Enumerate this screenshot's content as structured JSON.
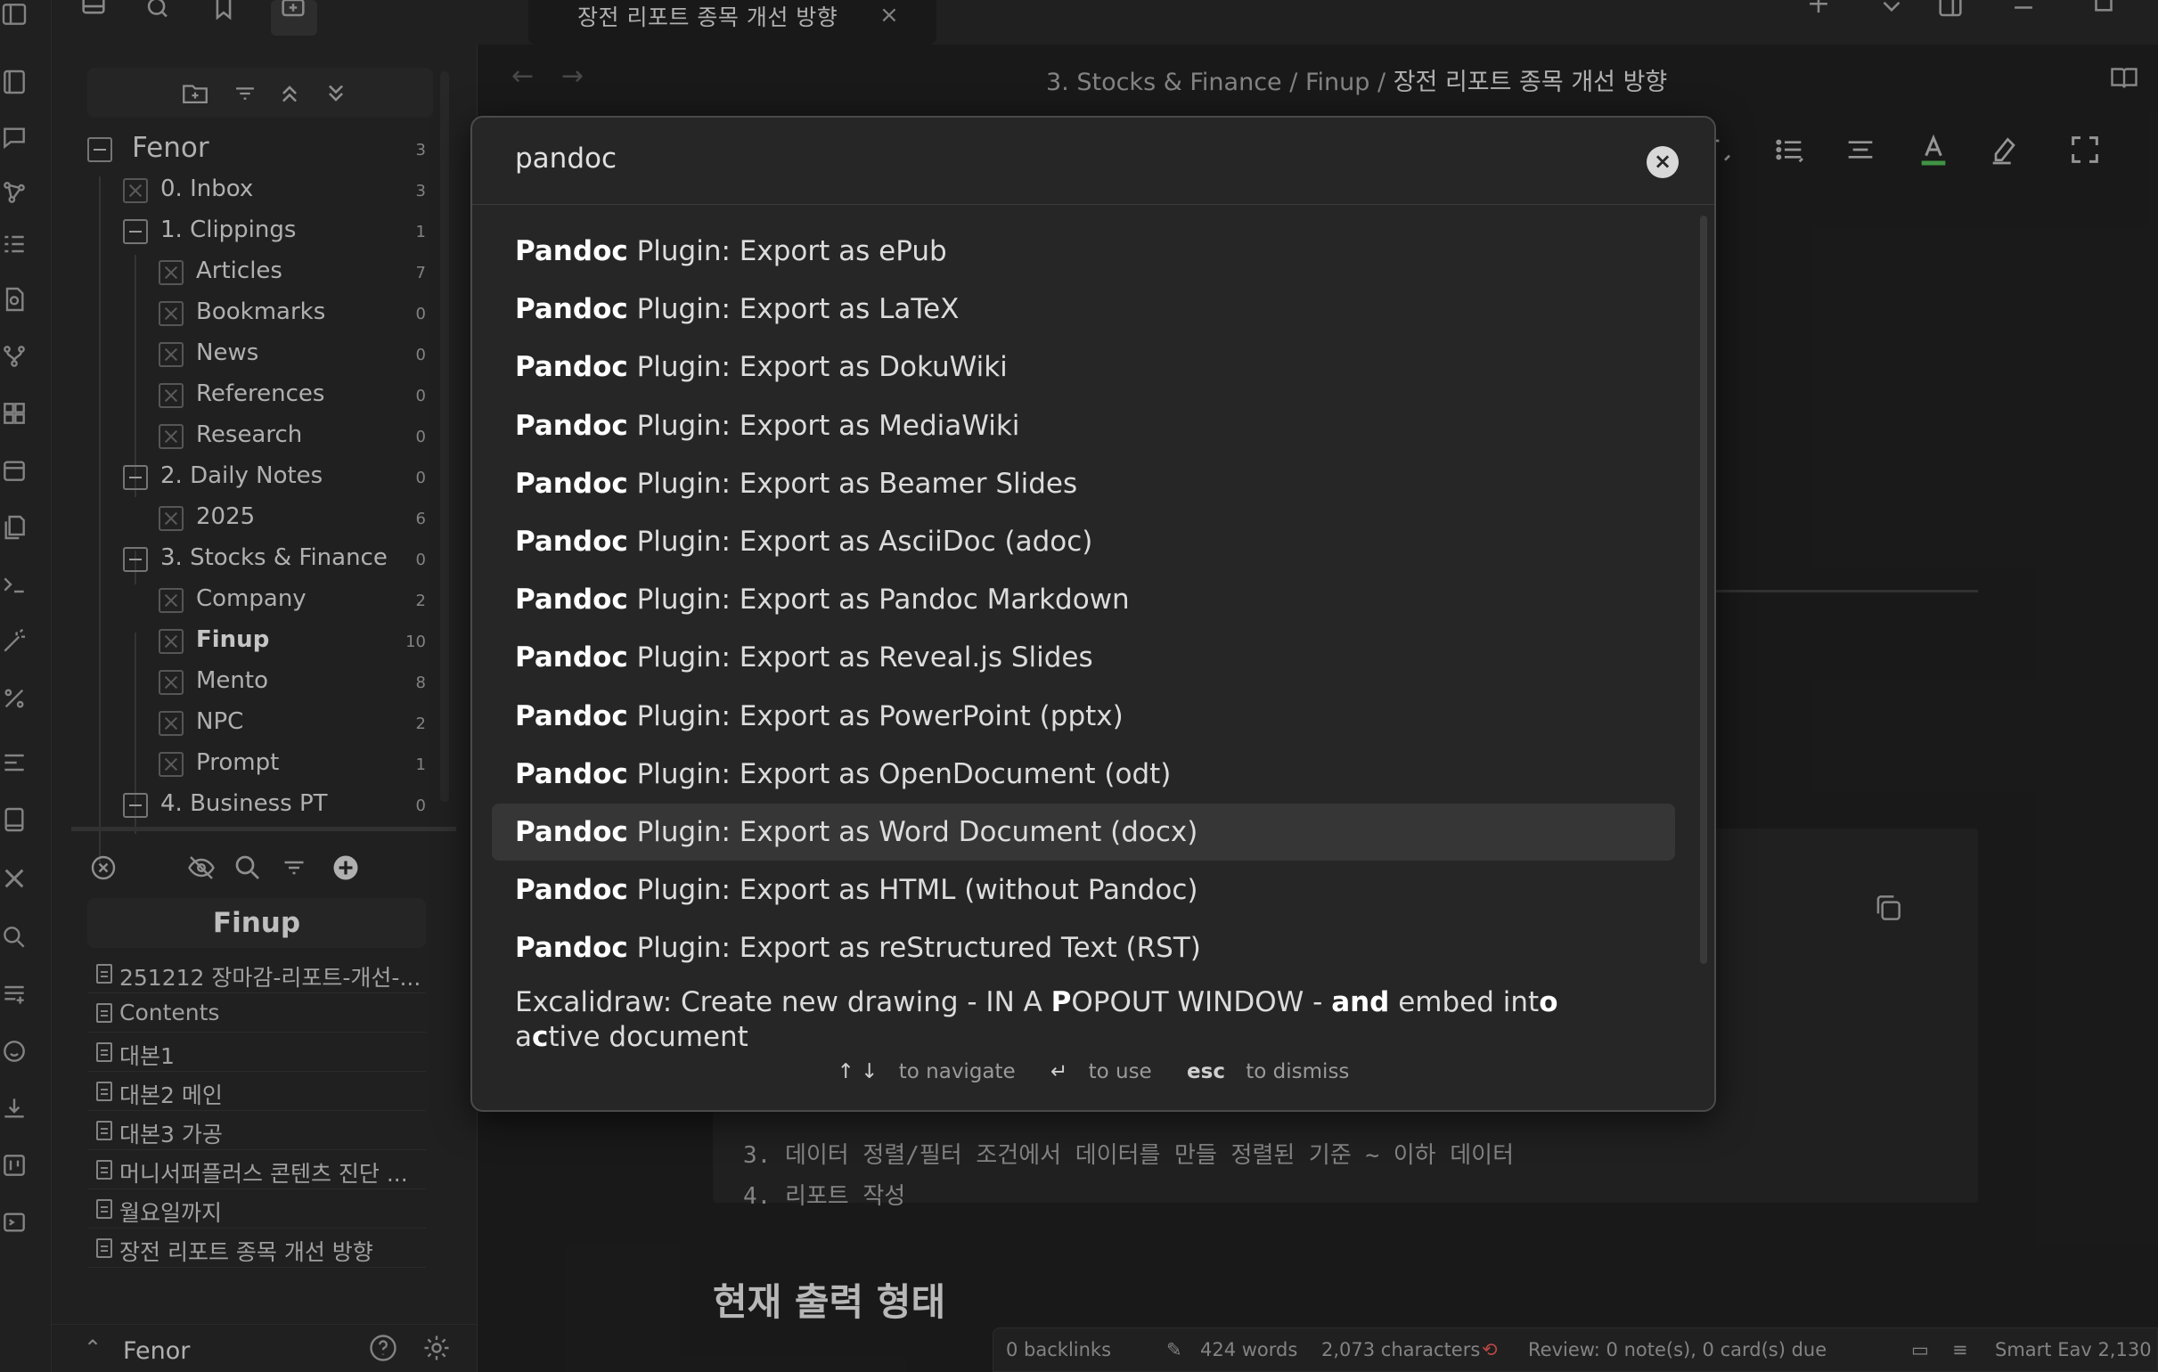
{
  "tab": {
    "title": "장전 리포트 종목 개선 방향",
    "close": "×"
  },
  "breadcrumb": {
    "part1": "3. Stocks & Finance",
    "sep1": "/",
    "part2": "Finup",
    "sep2": "/",
    "current": "장전 리포트 종목 개선 방향"
  },
  "nav": {
    "back": "←",
    "forward": "→"
  },
  "tree": {
    "root": {
      "label": "Fenor",
      "count": "3"
    },
    "items": [
      {
        "label": "0. Inbox",
        "count": "3"
      },
      {
        "label": "1. Clippings",
        "count": "1"
      },
      {
        "label": "Articles",
        "count": "7"
      },
      {
        "label": "Bookmarks",
        "count": "0"
      },
      {
        "label": "News",
        "count": "0"
      },
      {
        "label": "References",
        "count": "0"
      },
      {
        "label": "Research",
        "count": "0"
      },
      {
        "label": "2. Daily Notes",
        "count": "0"
      },
      {
        "label": "2025",
        "count": "6"
      },
      {
        "label": "3. Stocks & Finance",
        "count": "0"
      },
      {
        "label": "Company",
        "count": "2"
      },
      {
        "label": "Finup",
        "count": "10"
      },
      {
        "label": "Mento",
        "count": "8"
      },
      {
        "label": "NPC",
        "count": "2"
      },
      {
        "label": "Prompt",
        "count": "1"
      },
      {
        "label": "4. Business PT",
        "count": "0"
      }
    ]
  },
  "file_list": {
    "folder": "Finup",
    "files": [
      "251212 장마감-리포트-개선-...",
      "Contents",
      "대본1",
      "대본2 메인",
      "대본3 가공",
      "머니서퍼플러스 콘텐츠 진단 ...",
      "월요일까지",
      "장전 리포트 종목 개선 방향"
    ]
  },
  "vault": {
    "chevron": "⌃",
    "name": "Fenor"
  },
  "palette": {
    "query": "pandoc",
    "clear": "×",
    "results": [
      {
        "match": "Pandoc",
        "rest": " Plugin: Export as ePub"
      },
      {
        "match": "Pandoc",
        "rest": " Plugin: Export as LaTeX"
      },
      {
        "match": "Pandoc",
        "rest": " Plugin: Export as DokuWiki"
      },
      {
        "match": "Pandoc",
        "rest": " Plugin: Export as MediaWiki"
      },
      {
        "match": "Pandoc",
        "rest": " Plugin: Export as Beamer Slides"
      },
      {
        "match": "Pandoc",
        "rest": " Plugin: Export as AsciiDoc (adoc)"
      },
      {
        "match": "Pandoc",
        "rest": " Plugin: Export as Pandoc Markdown"
      },
      {
        "match": "Pandoc",
        "rest": " Plugin: Export as Reveal.js Slides"
      },
      {
        "match": "Pandoc",
        "rest": " Plugin: Export as PowerPoint (pptx)"
      },
      {
        "match": "Pandoc",
        "rest": " Plugin: Export as OpenDocument (odt)"
      },
      {
        "match": "Pandoc",
        "rest": " Plugin: Export as Word Document (docx)"
      },
      {
        "match": "Pandoc",
        "rest": " Plugin: Export as HTML (without Pandoc)"
      },
      {
        "match": "Pandoc",
        "rest": " Plugin: Export as reStructured Text (RST)"
      }
    ],
    "selected_index": 10,
    "last_result": {
      "t1": "Excalidraw: Create new drawing - IN A ",
      "b1": "P",
      "t2": "OPOUT WINDOW - ",
      "b2": "and",
      "t3": " embed int",
      "b3": "o",
      "t4": " a",
      "b4": "c",
      "t5": "tive document"
    },
    "footer": {
      "nav_keys": "↑ ↓",
      "nav_label": "to navigate",
      "use_key": "↵",
      "use_label": "to use",
      "dismiss_key": "esc",
      "dismiss_label": "to dismiss"
    }
  },
  "document": {
    "code_line_3": "3. 데이터 정렬/필터 조건에서 데이터를 만들 정렬된 기준 ~ 이하 데이터",
    "code_line_4_num": "4.",
    "code_line_4": "리포트 작성",
    "heading": "현재 출력 형태"
  },
  "status_bar": {
    "backlinks": "0 backlinks",
    "words": "424 words",
    "characters": "2,073 characters",
    "review": "Review: 0 note(s), 0 card(s) due",
    "smart": "Smart Eav 2,130"
  },
  "colors": {
    "accent_green": "#4caf50",
    "background": "#1e1e1e",
    "panel": "#262626",
    "selected": "#363636"
  }
}
